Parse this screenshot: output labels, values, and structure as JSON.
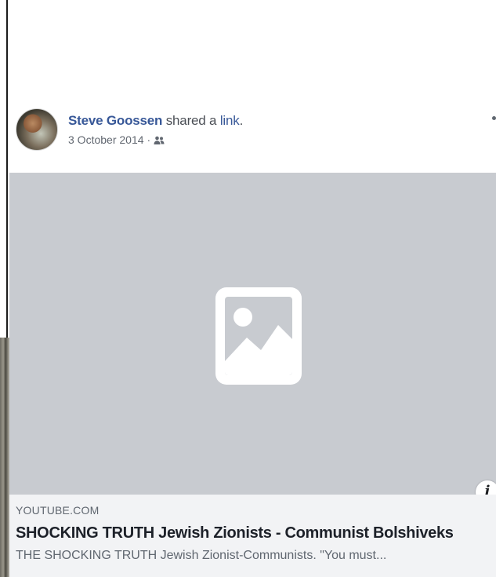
{
  "post": {
    "author": "Steve Goossen",
    "action_text": " shared a ",
    "action_link": "link",
    "action_end": ".",
    "date": "3 October 2014",
    "separator": "·",
    "audience_icon": "friends-icon"
  },
  "link_preview": {
    "image_placeholder_icon": "image-placeholder-icon",
    "info_icon_label": "i",
    "domain": "YOUTUBE.COM",
    "title": "SHOCKING TRUTH Jewish Zionists - Communist Bolshiveks",
    "description": "THE SHOCKING TRUTH Jewish Zionist-Communists. \"You must..."
  },
  "colors": {
    "author_link": "#385898",
    "image_placeholder_bg": "#c8cbd0",
    "caption_bg": "#f2f3f5"
  }
}
